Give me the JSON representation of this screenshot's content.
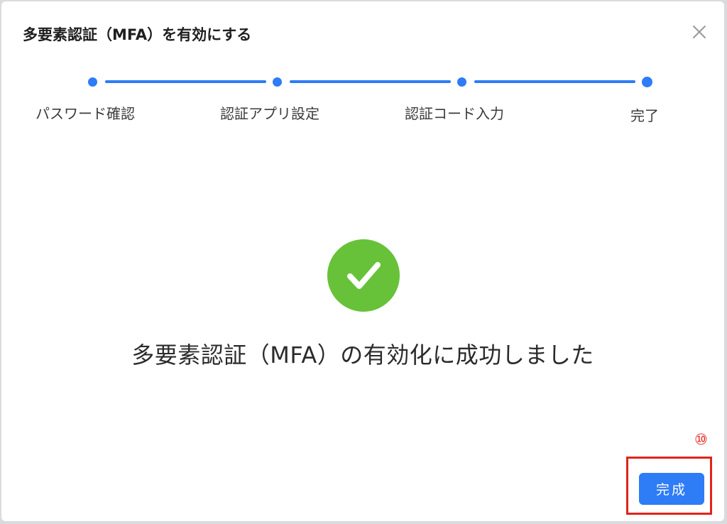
{
  "dialog": {
    "title": "多要素認証（MFA）を有効にする",
    "close_icon": "close-icon"
  },
  "stepper": {
    "steps": [
      {
        "label": "パスワード確認",
        "state": "done"
      },
      {
        "label": "認証アプリ設定",
        "state": "done"
      },
      {
        "label": "認証コード入力",
        "state": "done"
      },
      {
        "label": "完了",
        "state": "done"
      }
    ],
    "color": "#2e7cf6"
  },
  "result": {
    "icon": "check-circle-icon",
    "icon_color": "#67c23a",
    "message": "多要素認証（MFA）の有効化に成功しました"
  },
  "footer": {
    "marker": "⑩",
    "marker_color": "#e0241b",
    "done_label": "完成",
    "button_color": "#2e7cf6"
  }
}
